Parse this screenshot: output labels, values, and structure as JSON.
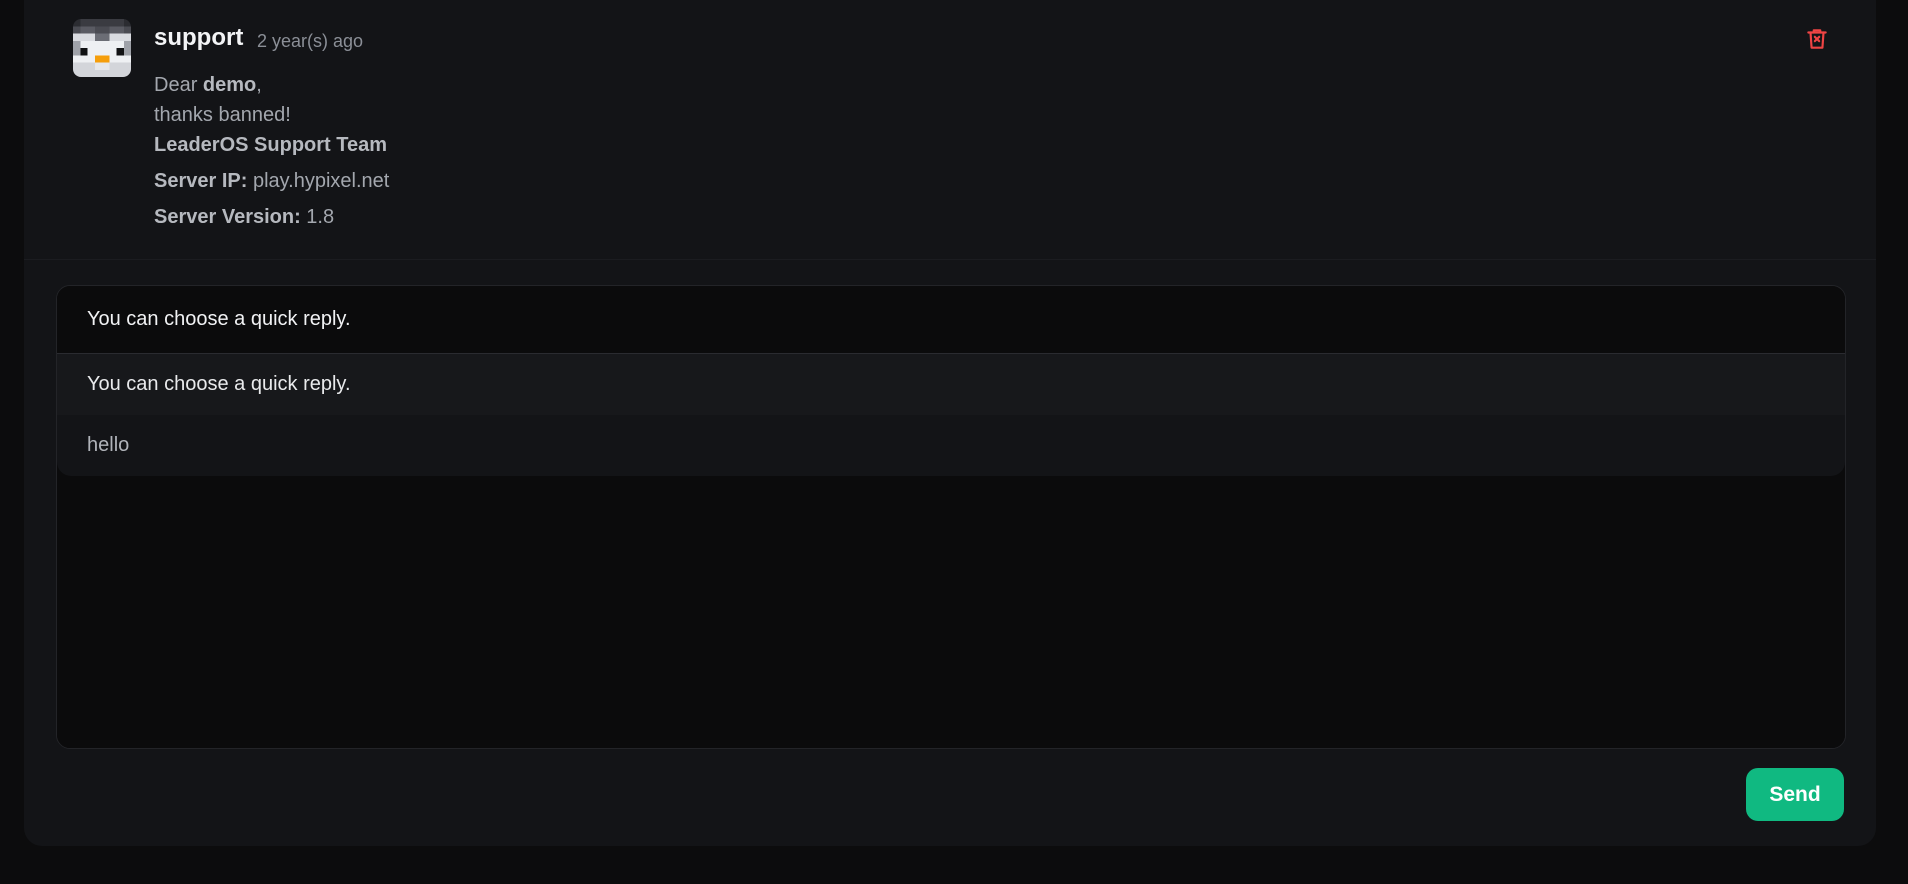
{
  "message": {
    "author": "support",
    "time": "2 year(s) ago",
    "greeting_prefix": "Dear ",
    "greeting_name": "demo",
    "greeting_suffix": ",",
    "text": "thanks banned!",
    "signature": "LeaderOS Support Team",
    "server_ip_label": "Server IP:",
    "server_ip_value": " play.hypixel.net",
    "server_version_label": "Server Version:",
    "server_version_value": " 1.8",
    "delete_icon": "trash-icon",
    "delete_color": "#ef4444"
  },
  "reply": {
    "quick_reply_selected": "You can choose a quick reply.",
    "options": [
      "You can choose a quick reply.",
      "hello"
    ],
    "textarea_value": "",
    "send_label": "Send",
    "send_color": "#10b981"
  }
}
